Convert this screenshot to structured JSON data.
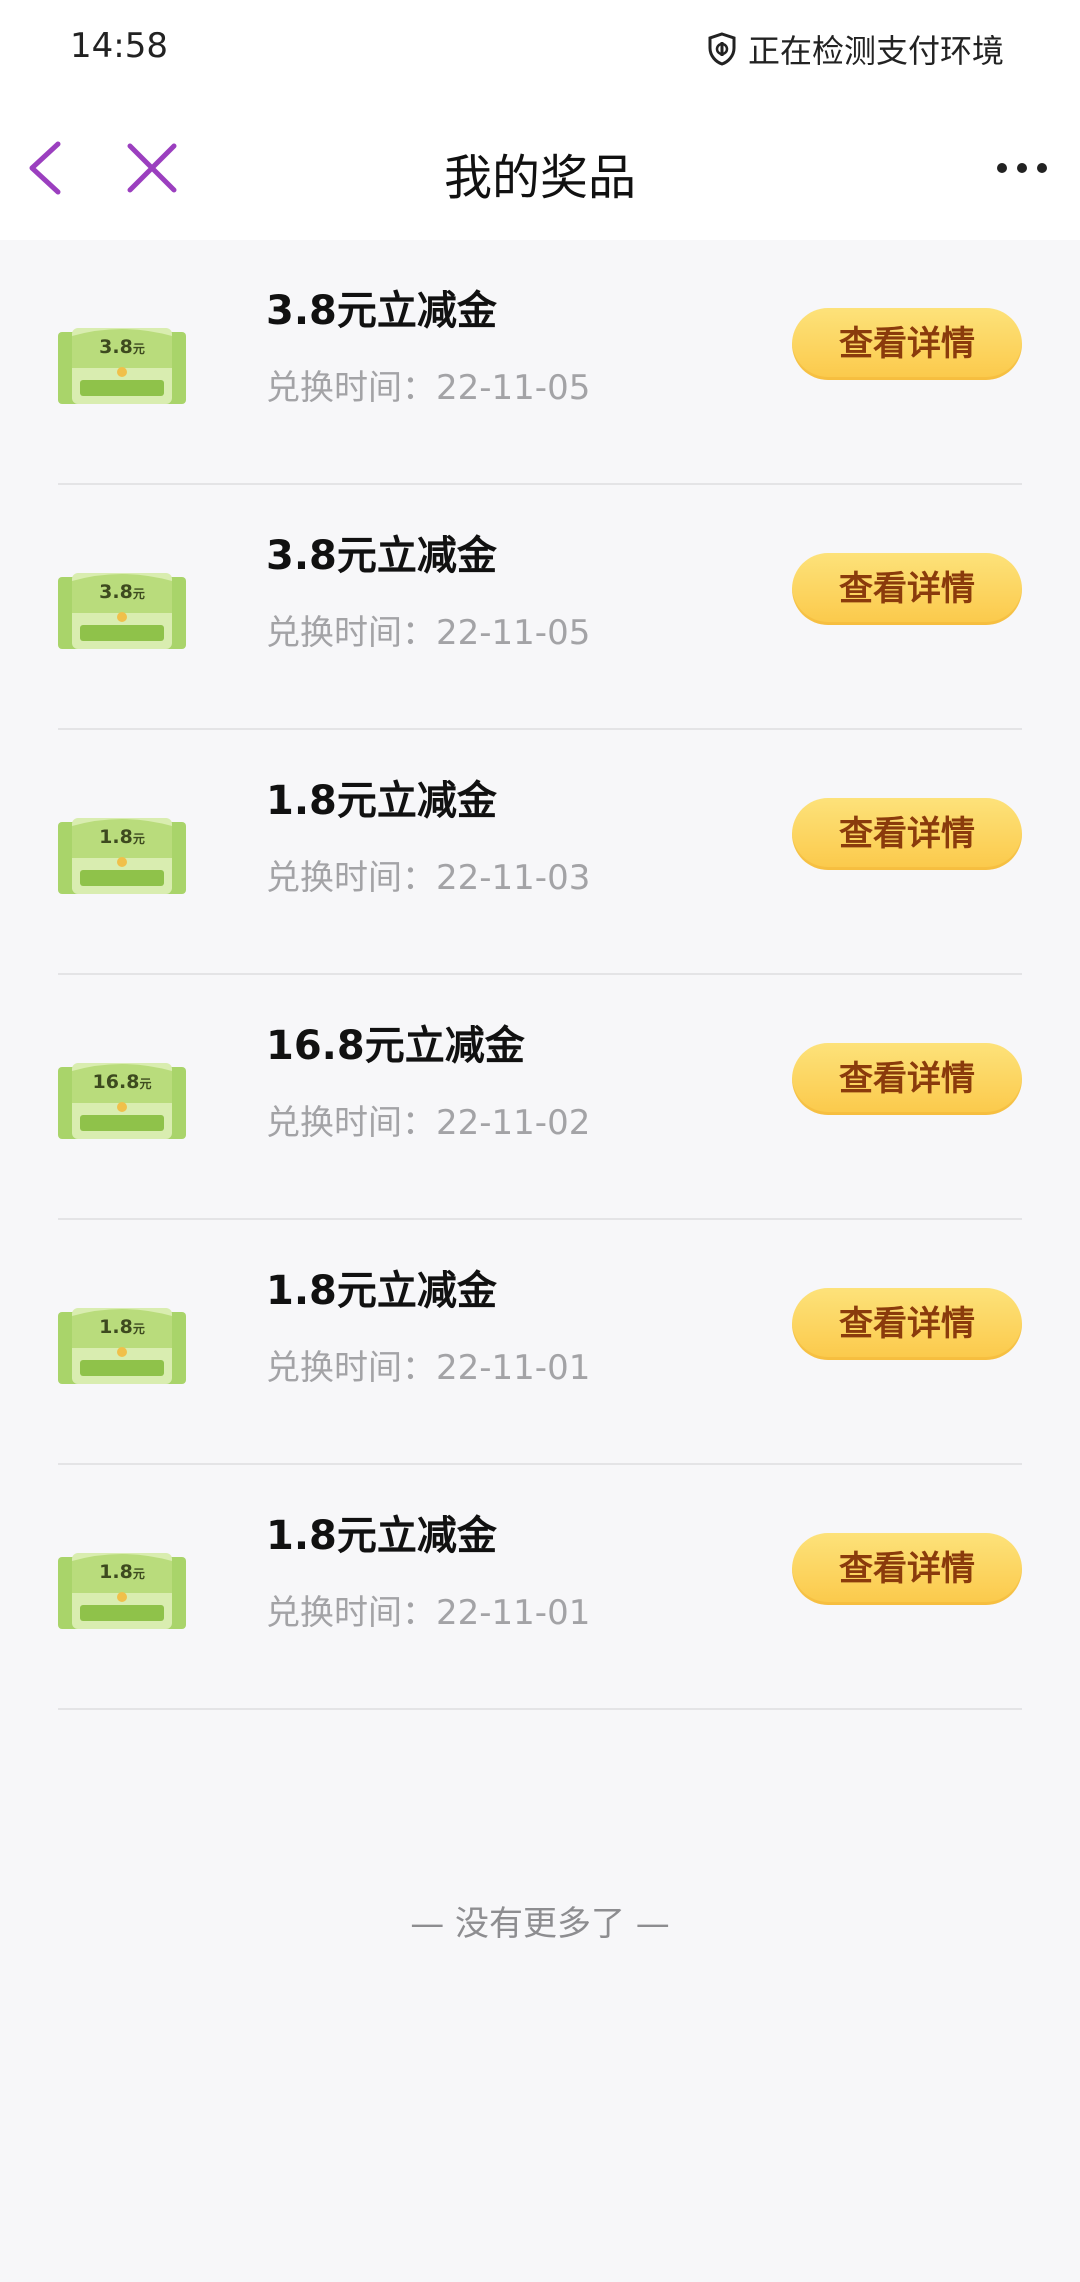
{
  "status_bar": {
    "time": "14:58",
    "payment_status": "正在检测支付环境"
  },
  "nav": {
    "title": "我的奖品"
  },
  "prizes": [
    {
      "badge_value": "3.8",
      "badge_unit": "元",
      "title": "3.8元立减金",
      "time_label": "兑换时间：",
      "time_value": "22-11-05",
      "button": "查看详情"
    },
    {
      "badge_value": "3.8",
      "badge_unit": "元",
      "title": "3.8元立减金",
      "time_label": "兑换时间：",
      "time_value": "22-11-05",
      "button": "查看详情"
    },
    {
      "badge_value": "1.8",
      "badge_unit": "元",
      "title": "1.8元立减金",
      "time_label": "兑换时间：",
      "time_value": "22-11-03",
      "button": "查看详情"
    },
    {
      "badge_value": "16.8",
      "badge_unit": "元",
      "title": "16.8元立减金",
      "time_label": "兑换时间：",
      "time_value": "22-11-02",
      "button": "查看详情"
    },
    {
      "badge_value": "1.8",
      "badge_unit": "元",
      "title": "1.8元立减金",
      "time_label": "兑换时间：",
      "time_value": "22-11-01",
      "button": "查看详情"
    },
    {
      "badge_value": "1.8",
      "badge_unit": "元",
      "title": "1.8元立减金",
      "time_label": "兑换时间：",
      "time_value": "22-11-01",
      "button": "查看详情"
    }
  ],
  "footer": {
    "no_more": "— 没有更多了 —"
  },
  "colors": {
    "accent_purple": "#9b3fbf",
    "button_gold": "#fbc94a",
    "button_text": "#8a3b0c",
    "coupon_green": "#8fc24a"
  },
  "icons": {
    "back": "chevron-left-icon",
    "close": "close-icon",
    "more": "more-icon",
    "shield": "shield-icon",
    "coupon": "wechat-coupon-icon"
  }
}
